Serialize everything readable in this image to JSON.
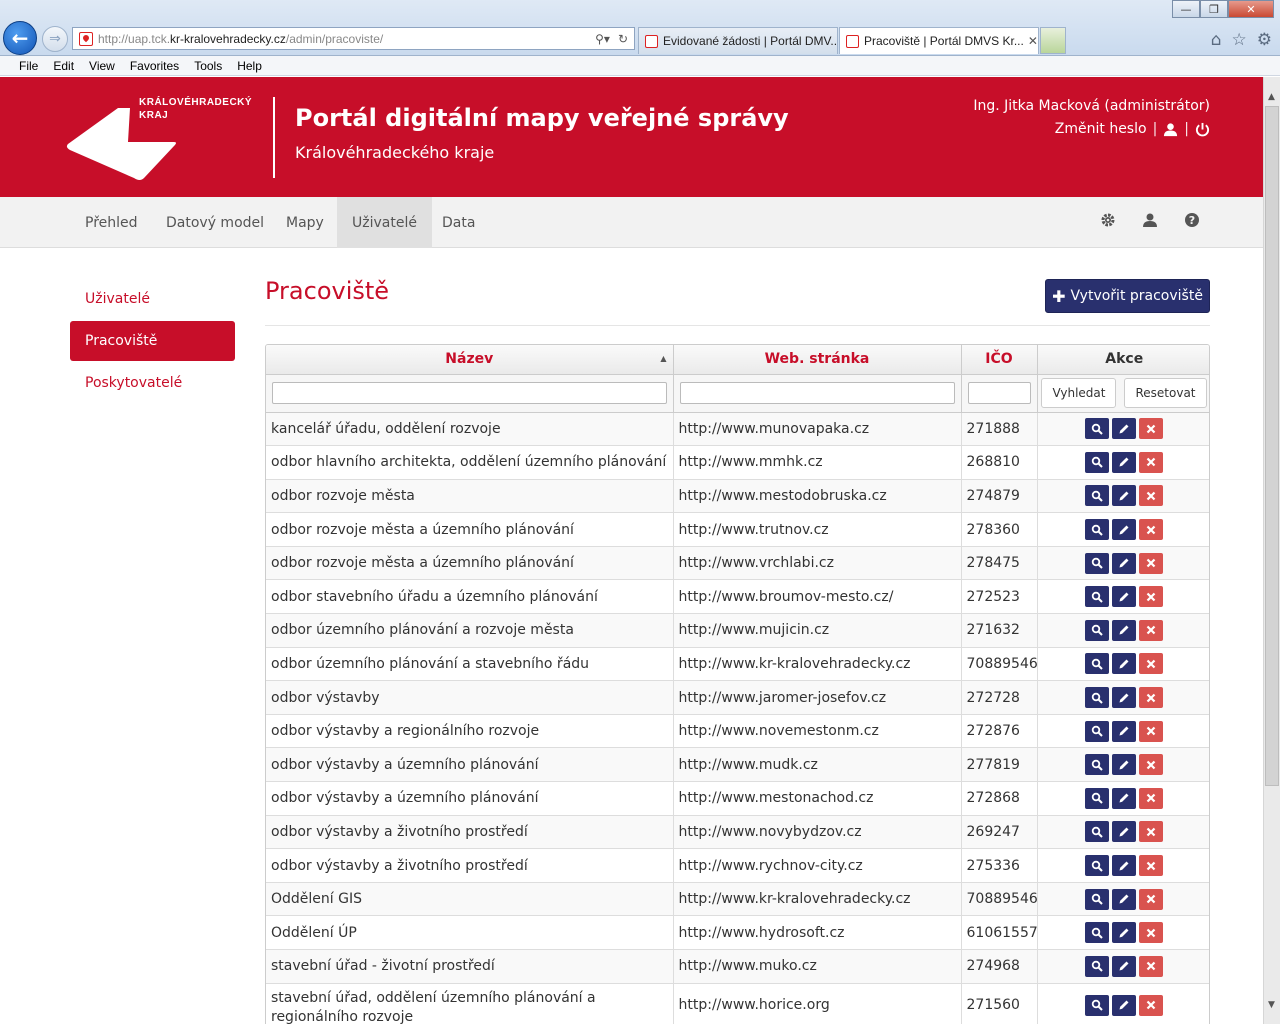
{
  "browser": {
    "url_prefix": "http://uap.tck.",
    "url_domain": "kr-kralovehradecky.cz",
    "url_path": "/admin/pracoviste/",
    "tabs": [
      {
        "label": "Evidované žádosti | Portál DMV..."
      },
      {
        "label": "Pracoviště | Portál DMVS Kr..."
      }
    ],
    "menu": [
      "File",
      "Edit",
      "View",
      "Favorites",
      "Tools",
      "Help"
    ]
  },
  "header": {
    "logo_line1": "KRÁLOVÉHRADECKÝ",
    "logo_line2": "KRAJ",
    "title": "Portál digitální mapy veřejné správy",
    "subtitle": "Královéhradeckého kraje",
    "user": "Ing. Jitka Macková (administrátor)",
    "change_password": "Změnit heslo",
    "separator": "|"
  },
  "nav": {
    "items": [
      "Přehled",
      "Datový model",
      "Mapy",
      "Uživatelé",
      "Data"
    ],
    "active": "Uživatelé"
  },
  "sidebar": {
    "items": [
      "Uživatelé",
      "Pracoviště",
      "Poskytovatelé"
    ],
    "active": "Pracoviště"
  },
  "main": {
    "title": "Pracoviště",
    "create_button": "Vytvořit pracoviště",
    "columns": [
      "Název",
      "Web. stránka",
      "IČO",
      "Akce"
    ],
    "search_button": "Vyhledat",
    "reset_button": "Resetovat",
    "rows": [
      {
        "name": "kancelář úřadu, oddělení rozvoje",
        "web": "http://www.munovapaka.cz",
        "ico": "271888"
      },
      {
        "name": "odbor hlavního architekta, oddělení územního plánování",
        "web": "http://www.mmhk.cz",
        "ico": "268810"
      },
      {
        "name": "odbor rozvoje města",
        "web": "http://www.mestodobruska.cz",
        "ico": "274879"
      },
      {
        "name": "odbor rozvoje města a územního plánování",
        "web": "http://www.trutnov.cz",
        "ico": "278360"
      },
      {
        "name": "odbor rozvoje města a územního plánování",
        "web": "http://www.vrchlabi.cz",
        "ico": "278475"
      },
      {
        "name": "odbor stavebního úřadu a územního plánování",
        "web": "http://www.broumov-mesto.cz/",
        "ico": "272523"
      },
      {
        "name": "odbor územního plánování a rozvoje města",
        "web": "http://www.mujicin.cz",
        "ico": "271632"
      },
      {
        "name": "odbor územního plánování a stavebního řádu",
        "web": "http://www.kr-kralovehradecky.cz",
        "ico": "70889546"
      },
      {
        "name": "odbor výstavby",
        "web": "http://www.jaromer-josefov.cz",
        "ico": "272728"
      },
      {
        "name": "odbor výstavby a regionálního rozvoje",
        "web": "http://www.novemestonm.cz",
        "ico": "272876"
      },
      {
        "name": "odbor výstavby a územního plánování",
        "web": "http://www.mudk.cz",
        "ico": "277819"
      },
      {
        "name": "odbor výstavby a územního plánování",
        "web": "http://www.mestonachod.cz",
        "ico": "272868"
      },
      {
        "name": "odbor výstavby a životního prostředí",
        "web": "http://www.novybydzov.cz",
        "ico": "269247"
      },
      {
        "name": "odbor výstavby a životního prostředí",
        "web": "http://www.rychnov-city.cz",
        "ico": "275336"
      },
      {
        "name": "Oddělení GIS",
        "web": "http://www.kr-kralovehradecky.cz",
        "ico": "70889546"
      },
      {
        "name": "Oddělení ÚP",
        "web": "http://www.hydrosoft.cz",
        "ico": "61061557"
      },
      {
        "name": "stavební úřad - životní prostředí",
        "web": "http://www.muko.cz",
        "ico": "274968"
      },
      {
        "name": "stavební úřad, oddělení územního plánování a regionálního rozvoje",
        "web": "http://www.horice.org",
        "ico": "271560"
      }
    ]
  },
  "colors": {
    "brand_red": "#c70e29",
    "button_navy": "#29306e",
    "delete_red": "#d9534f"
  },
  "icons": [
    "back-arrow-icon",
    "forward-arrow-icon",
    "search-icon",
    "refresh-icon",
    "home-icon",
    "star-icon",
    "gear-icon",
    "user-icon",
    "power-icon",
    "help-icon",
    "plus-icon",
    "magnifier-icon",
    "pencil-icon",
    "close-icon",
    "sort-asc-icon"
  ]
}
